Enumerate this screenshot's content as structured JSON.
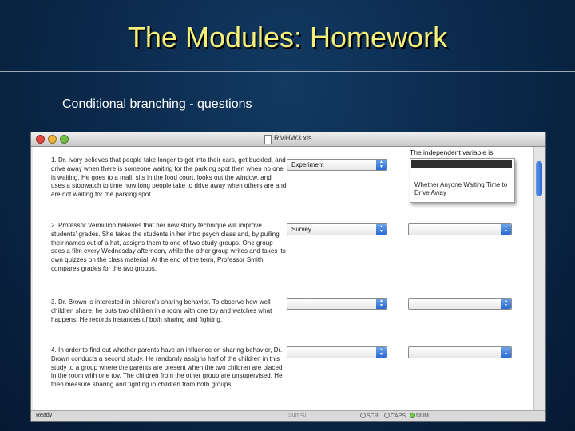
{
  "slide": {
    "title": "The Modules: Homework",
    "subtitle": "Conditional branching - questions"
  },
  "window": {
    "filename": "RMHW3.xls"
  },
  "independent_variable_label": "The independent variable is:",
  "questions": [
    {
      "text": "1. Dr. Ivory believes that people take longer to get into their cars, get buckled, and drive away when there is someone waiting for the parking spot then when no one is waiting. He goes to a mall, sits in the food court, looks out the window, and uses a stopwatch to time how long people take to drive away when others are and are not waiting for the parking spot.",
      "method_value": "Experiment",
      "iv_value": ""
    },
    {
      "text": "2. Professor Vermillion believes that her new study technique will improve students' grades. She takes the students in her intro psych class and, by pulling their names out of a hat, assigns them to one of two study groups. One group sees a film every Wednesday afternoon, while the other group writes and takes its own quizzes on the class material. At the end of the term, Professor Smith compares grades for the two groups.",
      "method_value": "Survey",
      "iv_value": ""
    },
    {
      "text": "3. Dr. Brown is interested in children's sharing behavior. To observe how well children share, he puts two children in a room with one toy and watches what happens. He records instances of both sharing and fighting.",
      "method_value": "",
      "iv_value": ""
    },
    {
      "text": "4. In order to find out whether parents have an influence on sharing behavior, Dr. Brown conducts a second study. He randomly assigns half of the children in this study to a group where the parents are present when the two children are placed in the room with one toy. The children from the other group are unsupervised. He then measure sharing and fighting in children from both groups.",
      "method_value": "",
      "iv_value": ""
    }
  ],
  "dropdown_open": {
    "highlighted_option": "",
    "option": "Whether Anyone Waiting Time to Drive Away"
  },
  "statusbar": {
    "ready": "Ready",
    "sum": "Sum=0",
    "scrl": "SCRL",
    "caps": "CAPS",
    "num": "NUM"
  },
  "colors": {
    "title_yellow": "#f4f07a",
    "background_navy": "#0b2a4c",
    "aqua_blue": "#2c6bd1"
  }
}
